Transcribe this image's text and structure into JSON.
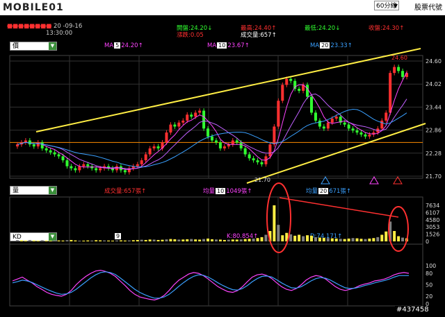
{
  "header": {
    "logo": "MOBILE01",
    "timeframe": "60分線",
    "stock_code_label": "股票代號",
    "stock_code_value": "",
    "date": "20 -09-16",
    "time": "13:30:00"
  },
  "quote": {
    "open": "開盤:24.20↓",
    "change": "漲跌:0.05",
    "high": "最高:24.40↑",
    "volume": "成交量:657↑",
    "low": "最低:24.20↓",
    "close": "收盤:24.30↑"
  },
  "price_panel": {
    "select": "價",
    "ma5_prefix": "MA",
    "ma5_period": "5",
    "ma5_value": "24.20↑",
    "ma10_prefix": "MA",
    "ma10_period": "10",
    "ma10_value": "23.67↑",
    "ma20_prefix": "MA",
    "ma20_period": "20",
    "ma20_value": "23.33↑",
    "peak_label": "24.60",
    "low_label": "21.70"
  },
  "volume_panel": {
    "select": "量",
    "vol_label": "成交量:657張↑",
    "avg10_prefix": "均量",
    "avg10_period": "10",
    "avg10_value": "1049張↑",
    "avg20_prefix": "均量",
    "avg20_period": "20",
    "avg20_value": "671張↑"
  },
  "kd_panel": {
    "select": "KD",
    "period": "9",
    "k_label": "K:80.854↑",
    "d_label": "D:74.171↑"
  },
  "watermark": "#437458",
  "colors": {
    "up": "#ff3030",
    "down": "#30ff30",
    "trend": "#ffee44",
    "ma5": "#ff44ff",
    "ma20": "#3aa0ff"
  },
  "chart_data": [
    {
      "type": "candlestick",
      "title": "價",
      "y_ticks": [
        "24.60",
        "24.02",
        "23.44",
        "22.86",
        "22.28",
        "21.70"
      ],
      "ylim": [
        21.7,
        24.6
      ],
      "close": [
        22.5,
        22.55,
        22.6,
        22.5,
        22.45,
        22.55,
        22.4,
        22.35,
        22.3,
        22.25,
        22.2,
        22.1,
        21.95,
        21.9,
        21.85,
        21.95,
        22.0,
        21.95,
        21.9,
        21.85,
        21.9,
        21.95,
        21.9,
        21.85,
        21.95,
        21.85,
        21.8,
        21.9,
        21.95,
        22.0,
        22.1,
        22.25,
        22.4,
        22.45,
        22.4,
        22.55,
        22.8,
        23.0,
        22.95,
        23.05,
        23.1,
        23.25,
        23.2,
        23.3,
        23.35,
        22.9,
        22.7,
        22.6,
        22.55,
        22.4,
        22.45,
        22.5,
        22.6,
        22.55,
        22.4,
        22.25,
        22.15,
        22.1,
        22.05,
        22.0,
        22.2,
        22.5,
        22.95,
        23.6,
        24.0,
        24.15,
        24.1,
        23.9,
        23.85,
        24.0,
        23.7,
        23.3,
        23.1,
        22.95,
        22.9,
        23.05,
        23.15,
        23.2,
        23.05,
        23.0,
        22.9,
        22.85,
        22.8,
        22.75,
        22.7,
        22.75,
        22.8,
        22.9,
        23.1,
        23.3,
        24.3,
        24.45,
        24.35,
        24.2,
        24.3
      ]
    },
    {
      "type": "bar",
      "title": "量",
      "y_ticks": [
        "7634",
        "6107",
        "4580",
        "3053",
        "1526",
        "0"
      ],
      "ylim": [
        0,
        7634
      ],
      "values": [
        300,
        250,
        200,
        300,
        220,
        180,
        260,
        200,
        150,
        240,
        200,
        180,
        260,
        300,
        200,
        150,
        160,
        200,
        180,
        250,
        220,
        200,
        180,
        160,
        200,
        220,
        180,
        200,
        250,
        300,
        350,
        300,
        400,
        380,
        300,
        350,
        420,
        500,
        450,
        380,
        400,
        450,
        500,
        420,
        380,
        500,
        600,
        450,
        400,
        380,
        300,
        350,
        400,
        380,
        420,
        500,
        550,
        600,
        700,
        900,
        1400,
        2200,
        7634,
        3500,
        1300,
        1800,
        1500,
        1200,
        1400,
        1100,
        1300,
        1200,
        900,
        800,
        750,
        700,
        650,
        600,
        550,
        500,
        600,
        700,
        650,
        550,
        500,
        600,
        700,
        900,
        1400,
        2100,
        4200,
        2200,
        1100,
        800,
        657
      ]
    },
    {
      "type": "line",
      "title": "KD",
      "y_ticks": [
        "100",
        "80",
        "50",
        "20",
        "0"
      ],
      "ylim": [
        0,
        100
      ],
      "series": [
        {
          "name": "K",
          "values": [
            60,
            65,
            70,
            62,
            55,
            45,
            38,
            30,
            25,
            22,
            20,
            25,
            35,
            50,
            62,
            72,
            80,
            86,
            88,
            85,
            80,
            72,
            60,
            48,
            35,
            25,
            18,
            15,
            12,
            10,
            14,
            22,
            35,
            50,
            62,
            70,
            78,
            82,
            80,
            74,
            65,
            55,
            45,
            38,
            32,
            30,
            35,
            45,
            58,
            70,
            76,
            78,
            74,
            66,
            55,
            45,
            38,
            35,
            40,
            50,
            62,
            70,
            74,
            72,
            65,
            55,
            45,
            38,
            35,
            38,
            42,
            48,
            52,
            55,
            60,
            62,
            65,
            70,
            76,
            80,
            82,
            80
          ]
        },
        {
          "name": "D",
          "values": [
            55,
            58,
            62,
            60,
            56,
            50,
            44,
            38,
            33,
            28,
            25,
            26,
            30,
            38,
            48,
            58,
            68,
            76,
            82,
            84,
            82,
            77,
            68,
            58,
            48,
            38,
            30,
            24,
            19,
            15,
            15,
            18,
            25,
            35,
            46,
            56,
            65,
            72,
            76,
            75,
            70,
            63,
            55,
            48,
            42,
            37,
            36,
            40,
            48,
            58,
            66,
            72,
            73,
            70,
            63,
            55,
            48,
            42,
            41,
            45,
            52,
            60,
            66,
            69,
            67,
            62,
            55,
            48,
            42,
            40,
            41,
            44,
            48,
            51,
            55,
            58,
            61,
            65,
            70,
            74,
            74,
            74
          ]
        }
      ]
    }
  ]
}
